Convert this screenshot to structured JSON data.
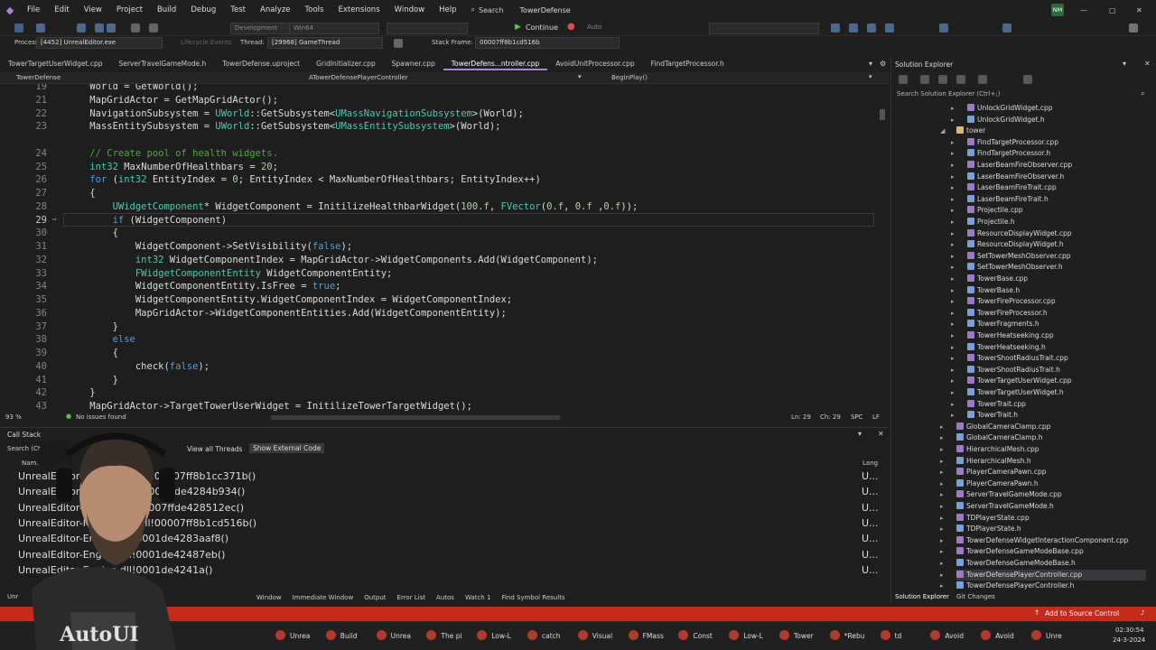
{
  "menubar": {
    "items": [
      "File",
      "Edit",
      "View",
      "Project",
      "Build",
      "Debug",
      "Test",
      "Analyze",
      "Tools",
      "Extensions",
      "Window",
      "Help"
    ],
    "search_label": "Search",
    "solution_name": "TowerDefense",
    "user_initials": "NM"
  },
  "toolbar": {
    "config": "Development",
    "platform": "Win64",
    "continue_label": "Continue",
    "auto_label": "Auto",
    "process_label": "Process:",
    "process_value": "[4452] UnrealEditor.exe",
    "lifecycle_label": "Lifecycle Events",
    "thread_label": "Thread:",
    "thread_value": "[29968] GameThread",
    "stack_frame_label": "Stack Frame:",
    "stack_frame_value": "00007ff8b1cd516b"
  },
  "doc_tabs": [
    {
      "label": "TowerTargetUserWidget.cpp",
      "active": false
    },
    {
      "label": "ServerTravelGameMode.h",
      "active": false
    },
    {
      "label": "TowerDefense.uproject",
      "active": false
    },
    {
      "label": "GridInitializer.cpp",
      "active": false
    },
    {
      "label": "Spawner.cpp",
      "active": false
    },
    {
      "label": "TowerDefens...ntroller.cpp",
      "active": true
    },
    {
      "label": "AvoidUnitProcessor.cpp",
      "active": false
    },
    {
      "label": "FindTargetProcessor.h",
      "active": false
    }
  ],
  "navbar": {
    "project": "TowerDefense",
    "scope": "ATowerDefensePlayerController",
    "member": "BeginPlay()"
  },
  "editor": {
    "lines": [
      {
        "n": "19",
        "t": "    World = GetWorld();"
      },
      {
        "n": "21",
        "t": "    MapGridActor = GetMapGridActor();"
      },
      {
        "n": "22",
        "t": "    NavigationSubsystem = UWorld::GetSubsystem<UMassNavigationSubsystem>(World);"
      },
      {
        "n": "23",
        "t": "    MassEntitySubsystem = UWorld::GetSubsystem<UMassEntitySubsystem>(World);"
      },
      {
        "n": "",
        "t": ""
      },
      {
        "n": "24",
        "t": "    // Create pool of health widgets."
      },
      {
        "n": "25",
        "t": "    int32 MaxNumberOfHealthbars = 20;"
      },
      {
        "n": "26",
        "t": "    for (int32 EntityIndex = 0; EntityIndex < MaxNumberOfHealthbars; EntityIndex++)"
      },
      {
        "n": "27",
        "t": "    {"
      },
      {
        "n": "28",
        "t": "        UWidgetComponent* WidgetComponent = InitilizeHealthbarWidget(100.f, FVector(0.f, 0.f ,0.f));"
      },
      {
        "n": "29",
        "t": "        if (WidgetComponent)"
      },
      {
        "n": "30",
        "t": "        {"
      },
      {
        "n": "31",
        "t": "            WidgetComponent->SetVisibility(false);"
      },
      {
        "n": "32",
        "t": "            int32 WidgetComponentIndex = MapGridActor->WidgetComponents.Add(WidgetComponent);"
      },
      {
        "n": "33",
        "t": "            FWidgetComponentEntity WidgetComponentEntity;"
      },
      {
        "n": "34",
        "t": "            WidgetComponentEntity.IsFree = true;"
      },
      {
        "n": "35",
        "t": "            WidgetComponentEntity.WidgetComponentIndex = WidgetComponentIndex;"
      },
      {
        "n": "36",
        "t": "            MapGridActor->WidgetComponentEntities.Add(WidgetComponentEntity);"
      },
      {
        "n": "37",
        "t": "        }"
      },
      {
        "n": "38",
        "t": "        else"
      },
      {
        "n": "39",
        "t": "        {"
      },
      {
        "n": "40",
        "t": "            check(false);"
      },
      {
        "n": "41",
        "t": "        }"
      },
      {
        "n": "42",
        "t": "    }"
      },
      {
        "n": "43",
        "t": "    MapGridActor->TargetTowerUserWidget = InitilizeTowerTargetWidget();"
      }
    ],
    "current_line": "29"
  },
  "editor_status": {
    "zoom": "93 %",
    "issues": "No issues found",
    "ln": "Ln: 29",
    "ch": "Ch: 29",
    "spc": "SPC",
    "crlf": "LF"
  },
  "solution_explorer": {
    "title": "Solution Explorer",
    "search_placeholder": "Search Solution Explorer (Ctrl+;)",
    "items": [
      {
        "label": "UnlockGridWidget.cpp",
        "type": "cpp",
        "indent": 2
      },
      {
        "label": "UnlockGridWidget.h",
        "type": "h",
        "indent": 2
      },
      {
        "label": "tower",
        "type": "folder",
        "indent": 1
      },
      {
        "label": "FindTargetProcessor.cpp",
        "type": "cpp",
        "indent": 2
      },
      {
        "label": "FindTargetProcessor.h",
        "type": "h",
        "indent": 2
      },
      {
        "label": "LaserBeamFireObserver.cpp",
        "type": "cpp",
        "indent": 2
      },
      {
        "label": "LaserBeamFireObserver.h",
        "type": "h",
        "indent": 2
      },
      {
        "label": "LaserBeamFireTrait.cpp",
        "type": "cpp",
        "indent": 2
      },
      {
        "label": "LaserBeamFireTrait.h",
        "type": "h",
        "indent": 2
      },
      {
        "label": "Projectile.cpp",
        "type": "cpp",
        "indent": 2
      },
      {
        "label": "Projectile.h",
        "type": "h",
        "indent": 2
      },
      {
        "label": "ResourceDisplayWidget.cpp",
        "type": "cpp",
        "indent": 2
      },
      {
        "label": "ResourceDisplayWidget.h",
        "type": "h",
        "indent": 2
      },
      {
        "label": "SetTowerMeshObserver.cpp",
        "type": "cpp",
        "indent": 2
      },
      {
        "label": "SetTowerMeshObserver.h",
        "type": "h",
        "indent": 2
      },
      {
        "label": "TowerBase.cpp",
        "type": "cpp",
        "indent": 2
      },
      {
        "label": "TowerBase.h",
        "type": "h",
        "indent": 2
      },
      {
        "label": "TowerFireProcessor.cpp",
        "type": "cpp",
        "indent": 2
      },
      {
        "label": "TowerFireProcessor.h",
        "type": "h",
        "indent": 2
      },
      {
        "label": "TowerFragments.h",
        "type": "h",
        "indent": 2
      },
      {
        "label": "TowerHeatseeking.cpp",
        "type": "cpp",
        "indent": 2
      },
      {
        "label": "TowerHeatseeking.h",
        "type": "h",
        "indent": 2
      },
      {
        "label": "TowerShootRadiusTrait.cpp",
        "type": "cpp",
        "indent": 2
      },
      {
        "label": "TowerShootRadiusTrait.h",
        "type": "h",
        "indent": 2
      },
      {
        "label": "TowerTargetUserWidget.cpp",
        "type": "cpp",
        "indent": 2
      },
      {
        "label": "TowerTargetUserWidget.h",
        "type": "h",
        "indent": 2
      },
      {
        "label": "TowerTrait.cpp",
        "type": "cpp",
        "indent": 2
      },
      {
        "label": "TowerTrait.h",
        "type": "h",
        "indent": 2
      },
      {
        "label": "GlobalCameraClamp.cpp",
        "type": "cpp",
        "indent": 1
      },
      {
        "label": "GlobalCameraClamp.h",
        "type": "h",
        "indent": 1
      },
      {
        "label": "HierarchicalMesh.cpp",
        "type": "cpp",
        "indent": 1
      },
      {
        "label": "HierarchicalMesh.h",
        "type": "h",
        "indent": 1
      },
      {
        "label": "PlayerCameraPawn.cpp",
        "type": "cpp",
        "indent": 1
      },
      {
        "label": "PlayerCameraPawn.h",
        "type": "h",
        "indent": 1
      },
      {
        "label": "ServerTravelGameMode.cpp",
        "type": "cpp",
        "indent": 1
      },
      {
        "label": "ServerTravelGameMode.h",
        "type": "h",
        "indent": 1
      },
      {
        "label": "TDPlayerState.cpp",
        "type": "cpp",
        "indent": 1
      },
      {
        "label": "TDPlayerState.h",
        "type": "h",
        "indent": 1
      },
      {
        "label": "TowerDefenseWidgetInteractionComponent.cpp",
        "type": "cpp",
        "indent": 1
      },
      {
        "label": "TowerDefenseGameModeBase.cpp",
        "type": "cpp",
        "indent": 1
      },
      {
        "label": "TowerDefenseGameModeBase.h",
        "type": "h",
        "indent": 1
      },
      {
        "label": "TowerDefensePlayerController.cpp",
        "type": "cpp",
        "indent": 1,
        "selected": true
      },
      {
        "label": "TowerDefensePlayerController.h",
        "type": "h",
        "indent": 1
      }
    ],
    "bottom_tabs": [
      "Solution Explorer",
      "Git Changes"
    ]
  },
  "call_stack": {
    "title": "Call Stack",
    "search_placeholder": "Search (Ctrl+E)",
    "view_threads": "View all Threads",
    "show_external": "Show External Code",
    "col_name": "Name",
    "col_lang": "Lang",
    "rows": [
      {
        "text": "UnrealEditor-MassEntity.dll!00007ff8b1cc371b()",
        "lang": "U..."
      },
      {
        "text": "UnrealEditor-Engine.dll!00007ffde4284b934()",
        "lang": "U..."
      },
      {
        "text": "UnrealEditor-Engine.dll!00007ffde428512ec()",
        "lang": "U..."
      },
      {
        "text": "UnrealEditor-MassEntity.dll!00007ff8b1cd516b()",
        "lang": "U..."
      },
      {
        "text": "UnrealEditor-Engine.dll!0001de4283aaf8()",
        "lang": "U..."
      },
      {
        "text": "UnrealEditor-Engine.dll!0001de42487eb()",
        "lang": "U..."
      },
      {
        "text": "UnrealEditor-Engine.dll!0001de4241a()",
        "lang": "U..."
      }
    ]
  },
  "bottom_tabs": [
    "Window",
    "Immediate Window",
    "Output",
    "Error List",
    "Autos",
    "Watch 1",
    "Find Symbol Results"
  ],
  "statusbar": {
    "left": "Unr",
    "source_control": "Add to Source Control"
  },
  "taskbar": {
    "items": [
      "Unrea",
      "Build",
      "Unrea",
      "The pi",
      "Low-L",
      "catch",
      "Visual",
      "FMass",
      "Const",
      "Low-L",
      "Tower",
      "*Rebu",
      "td",
      "Avoid",
      "Avoid",
      "Unre"
    ],
    "time": "02:30:54",
    "date": "24-3-2024"
  },
  "colors": {
    "accent": "#b180d7",
    "status": "#c42b1c",
    "keyword": "#569cd6",
    "type": "#4ec9b0",
    "function": "#dcdcaa",
    "comment": "#57a64a",
    "number": "#b5cea8"
  }
}
